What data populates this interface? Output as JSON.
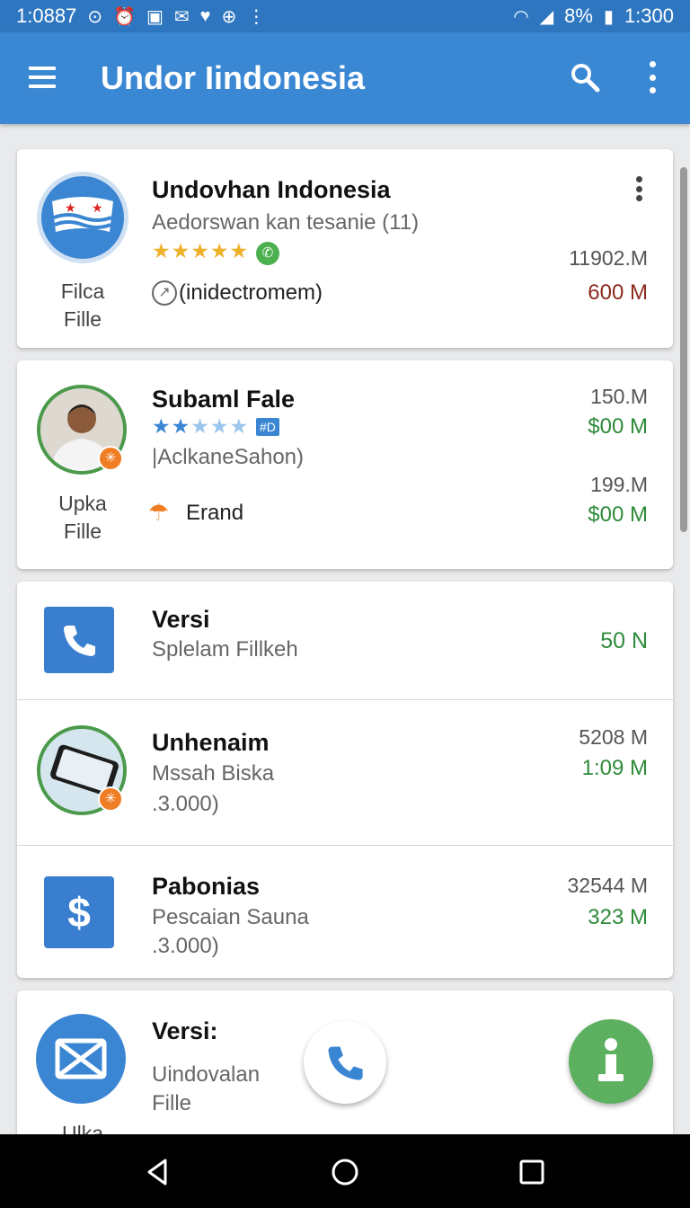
{
  "status_bar": {
    "time": "1:0887",
    "battery": "8%",
    "clock": "1:300"
  },
  "app_bar": {
    "title": "Undor Iindonesia"
  },
  "items": [
    {
      "title": "Undovhan Indonesia",
      "subtitle": "Aedorswan kan tesanie (11)",
      "tag": "(inidectromem)",
      "side_label_1": "Filca",
      "side_label_2": "Fille",
      "value_1": "11902.M",
      "value_2": "600 M",
      "value_2_color": "#8b2a1e"
    },
    {
      "title": "Subaml Fale",
      "badge": "#D",
      "subtitle": "|AclkaneSahon)",
      "tag": "Erand",
      "side_label_1": "Upka",
      "side_label_2": "Fille",
      "value_1": "150.M",
      "value_2": "$00 M",
      "value_3": "199.M",
      "value_4": "$00 M"
    },
    {
      "title": "Versi",
      "subtitle": "Splelam Fillkeh",
      "value_2": "50 N"
    },
    {
      "title": "Unhenaim",
      "subtitle": "Mssah Biska",
      "subtitle_2": ".3.000)",
      "value_1": "5208 M",
      "value_2": "1:09 M"
    },
    {
      "title": "Pabonias",
      "subtitle": "Pescaian Sauna",
      "subtitle_2": ".3.000)",
      "value_1": "32544 M",
      "value_2": "323 M"
    },
    {
      "title": "Versi:",
      "subtitle": "Uindovalan",
      "subtitle_2": "Fille",
      "side_label_1": "Ulka"
    }
  ],
  "colors": {
    "primary": "#3a87d4",
    "status": "#2e77c0",
    "green": "#2e8b3a",
    "fab_green": "#5cb05f"
  }
}
